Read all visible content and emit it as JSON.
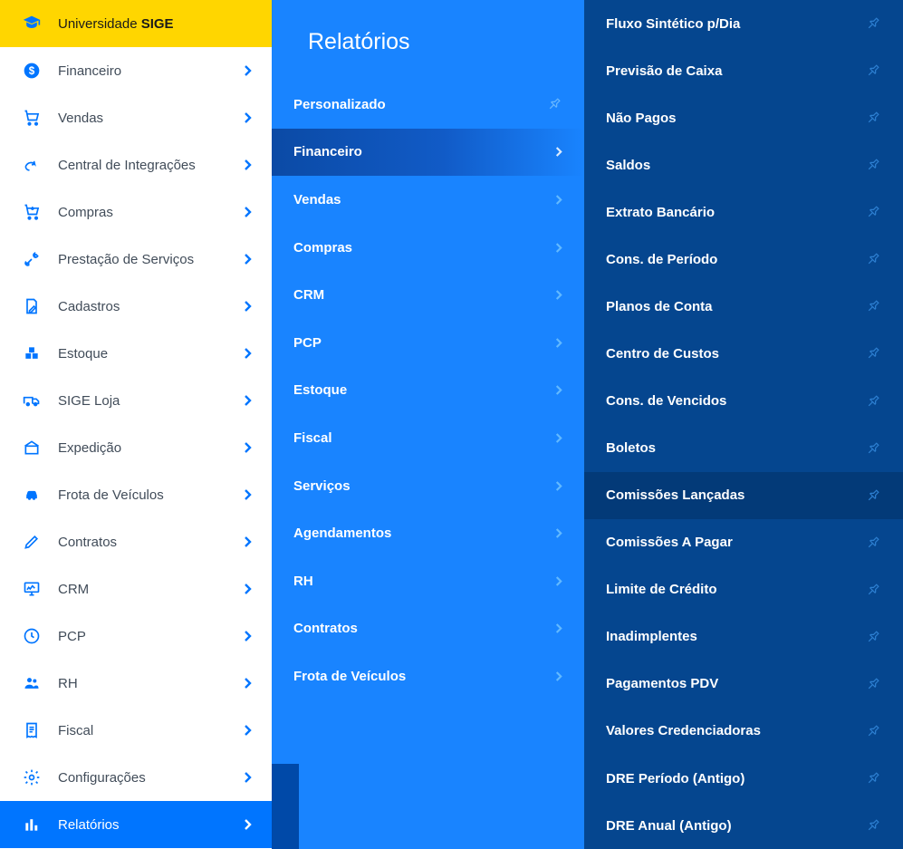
{
  "brand": {
    "prefix": "Universidade ",
    "bold": "SIGE"
  },
  "sidebar": [
    {
      "icon": "graduation",
      "label": "__BRAND__",
      "header": true,
      "noChev": true
    },
    {
      "icon": "dollar",
      "label": "Financeiro"
    },
    {
      "icon": "cart",
      "label": "Vendas"
    },
    {
      "icon": "share",
      "label": "Central de Integrações"
    },
    {
      "icon": "cartdown",
      "label": "Compras"
    },
    {
      "icon": "tools",
      "label": "Prestação de Serviços"
    },
    {
      "icon": "note",
      "label": "Cadastros"
    },
    {
      "icon": "boxes",
      "label": "Estoque"
    },
    {
      "icon": "van",
      "label": "SIGE Loja"
    },
    {
      "icon": "house",
      "label": "Expedição"
    },
    {
      "icon": "car",
      "label": "Frota de Veículos"
    },
    {
      "icon": "pen",
      "label": "Contratos"
    },
    {
      "icon": "monitor",
      "label": "CRM"
    },
    {
      "icon": "clock",
      "label": "PCP"
    },
    {
      "icon": "people",
      "label": "RH"
    },
    {
      "icon": "receipt",
      "label": "Fiscal"
    },
    {
      "icon": "gear",
      "label": "Configurações"
    },
    {
      "icon": "bars",
      "label": "Relatórios",
      "active": true
    }
  ],
  "catTitle": "Relatórios",
  "categories": [
    {
      "label": "Personalizado",
      "pin": true
    },
    {
      "label": "Financeiro",
      "active": true
    },
    {
      "label": "Vendas"
    },
    {
      "label": "Compras"
    },
    {
      "label": "CRM"
    },
    {
      "label": "PCP"
    },
    {
      "label": "Estoque"
    },
    {
      "label": "Fiscal"
    },
    {
      "label": "Serviços"
    },
    {
      "label": "Agendamentos"
    },
    {
      "label": "RH"
    },
    {
      "label": "Contratos"
    },
    {
      "label": "Frota de Veículos"
    }
  ],
  "reports": [
    {
      "label": "Fluxo Sintético p/Dia"
    },
    {
      "label": "Previsão de Caixa"
    },
    {
      "label": "Não Pagos"
    },
    {
      "label": "Saldos"
    },
    {
      "label": "Extrato Bancário"
    },
    {
      "label": "Cons. de Período"
    },
    {
      "label": "Planos de Conta"
    },
    {
      "label": "Centro de Custos"
    },
    {
      "label": "Cons. de Vencidos"
    },
    {
      "label": "Boletos"
    },
    {
      "label": "Comissões Lançadas",
      "active": true
    },
    {
      "label": "Comissões A Pagar"
    },
    {
      "label": "Limite de Crédito"
    },
    {
      "label": "Inadimplentes"
    },
    {
      "label": "Pagamentos PDV"
    },
    {
      "label": "Valores Credenciadoras"
    },
    {
      "label": "DRE Período (Antigo)"
    },
    {
      "label": "DRE Anual (Antigo)"
    }
  ]
}
